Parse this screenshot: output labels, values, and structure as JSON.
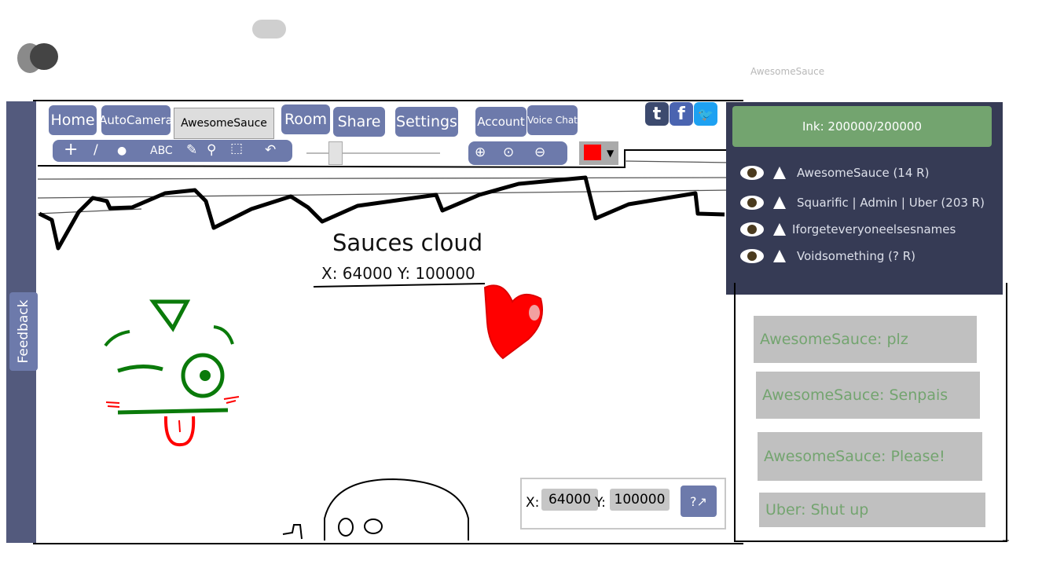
{
  "top": {
    "username": "AwesomeSauce"
  },
  "nav": {
    "home": "Home",
    "autocamera": "AutoCamera",
    "name_field": "AwesomeSauce",
    "room": "Room",
    "share": "Share",
    "settings": "Settings",
    "account": "Account",
    "voice_chat": "Voice Chat"
  },
  "tools": {
    "plus": "+",
    "line": "/",
    "dot": "●",
    "text": "ABC",
    "picker": "✎",
    "brush": "⚲",
    "select": "⬚",
    "undo": "↶"
  },
  "zoom": {
    "in": "⊕",
    "reset": "⊙",
    "out": "⊖"
  },
  "brush_size": 0.22,
  "color": {
    "current": "#ff0000",
    "arrow": "▼"
  },
  "social": {
    "tumblr": "t",
    "facebook": "f",
    "twitter": "🐦"
  },
  "sidebar": {
    "feedback": "Feedback"
  },
  "canvas": {
    "title": "Sauces cloud",
    "coords": "X: 64000 Y: 100000"
  },
  "coord_box": {
    "x_label": "X:",
    "x_value": "64000",
    "y_label": "Y:",
    "y_value": "100000",
    "go_label": "?↗"
  },
  "ink": {
    "label": "Ink: 200000/200000"
  },
  "users": [
    {
      "name": "AwesomeSauce (14 R)"
    },
    {
      "name": "Squarific | Admin | Uber (203 R)"
    },
    {
      "name": "Iforgeteveryoneelsesnames"
    },
    {
      "name": "Voidsomething (? R)"
    }
  ],
  "chat": [
    "AwesomeSauce: plz",
    "AwesomeSauce: Senpais",
    "AwesomeSauce: Please!",
    "Uber: Shut up"
  ],
  "colors": {
    "nav_blue": "#6d7aab",
    "panel_dark": "#363b55",
    "ink_green": "#73a46f",
    "chat_grey": "#c0c0c0"
  }
}
